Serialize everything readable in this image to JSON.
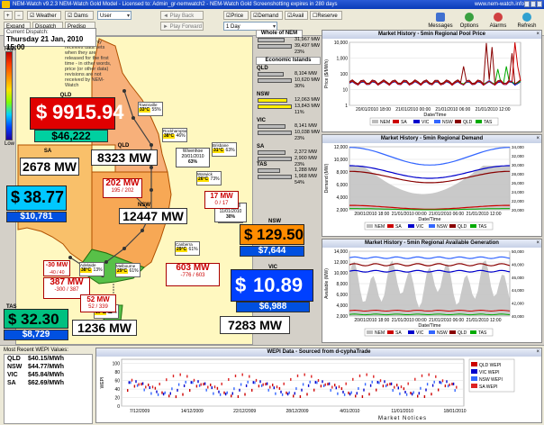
{
  "titlebar": {
    "text": "NEM-Watch v9.2.3 NEM-Watch Gold Model - Licensed to: Admin_gr-nemwatch2 - NEM-Watch Gold Screenshotting expires in 280 days",
    "right_text": "www.nem-watch.info"
  },
  "toolbar": {
    "weather_label": "Weather",
    "dams_label": "Dams",
    "user_select": "User",
    "play_back_label": "Play Back",
    "play_forward_label": "Play Forward",
    "price_label": "Price",
    "demand_label": "Demand",
    "avail_label": "Avail",
    "reserve_label": "Reserve",
    "period_select": "1 Day",
    "messages_label": "Messages",
    "options_label": "Options",
    "alarms_label": "Alarms",
    "refresh_label": "Refresh",
    "zoom_in": "Zoom In",
    "zoom_out": "Zoom Out",
    "expand_label": "Expand",
    "dispatch_label": "Dispatch",
    "predisp_label": "Predisp"
  },
  "dispatch": {
    "label": "Current Dispatch:",
    "time": "Thursday 21 Jan, 2010 15:00"
  },
  "legend": {
    "high": "High",
    "low": "Low"
  },
  "map": {
    "note": "NEM-Watch only receives data sets when they are released for the first time - in other words, price (or other data) revisions are not received by NEM-Watch",
    "weather_stations": [
      {
        "name": "Townsville",
        "temp": "33°C",
        "pct": "55%"
      },
      {
        "name": "Rockhampton",
        "temp": "38°C",
        "pct": "46%"
      },
      {
        "name": "Brisbane",
        "temp": "31°C",
        "pct": "63%"
      },
      {
        "name": "Warwick",
        "temp": "26°C",
        "pct": "73%"
      },
      {
        "name": "Sydney",
        "temp": "31°C",
        "pct": "63%"
      },
      {
        "name": "Canberra",
        "temp": "29°C",
        "pct": "61%"
      },
      {
        "name": "Melbourne",
        "temp": "29°C",
        "pct": "61%"
      },
      {
        "name": "Adelaide",
        "temp": "38°C",
        "pct": "13%"
      },
      {
        "name": "Hobart",
        "temp": "19°C",
        "pct": "53%"
      }
    ],
    "wivenhoe": {
      "name": "Wivenhoe",
      "date": "20/01/2010",
      "pct": "63%"
    },
    "lakelyell": {
      "name": "Lake Lyell",
      "date": "11/01/2010",
      "pct": "30%"
    }
  },
  "regions": {
    "qld": {
      "name": "QLD",
      "price": "9915.94",
      "demand": "$46,222",
      "mw": "8323 MW"
    },
    "sa": {
      "name": "SA",
      "price": "38.77",
      "demand": "$10,781",
      "mw": "2678 MW"
    },
    "nsw": {
      "name": "NSW",
      "price": "129.50",
      "demand": "$7,644",
      "mw": "12447 MW"
    },
    "vic": {
      "name": "VIC",
      "price": "10.89",
      "demand": "$6,988",
      "mw": "7283 MW"
    },
    "tas": {
      "name": "TAS",
      "price": "32.30",
      "demand": "$8,729",
      "mw": "1236 MW"
    },
    "dollar": "$"
  },
  "flows": {
    "qni": {
      "value": "202 MW",
      "range": "195 / 202"
    },
    "terr": {
      "value": "17 MW",
      "range": "0 / 17"
    },
    "vicnsw": {
      "value": "603 MW",
      "range": "-776 / 603"
    },
    "heywood": {
      "value": "387 MW",
      "range": "-300 / 387"
    },
    "murray": {
      "value": "-30 MW",
      "range": "-40 / 40"
    },
    "basslink": {
      "value": "52 MW",
      "range": "52 / 339"
    }
  },
  "side": {
    "header_nem": "Whole of NEM",
    "header_islands": "Economic Islands",
    "nem_vals": [
      "31,967 MW",
      "39,497 MW",
      "23%"
    ],
    "qld": {
      "label": "QLD",
      "vals": [
        "8,104 MW",
        "10,620 MW",
        "30%"
      ]
    },
    "nsw": {
      "label": "NSW",
      "vals": [
        "12,063 MW",
        "13,843 MW",
        "11%"
      ]
    },
    "vic": {
      "label": "VIC",
      "vals": [
        "8,141 MW",
        "10,038 MW",
        "23%"
      ]
    },
    "sa": {
      "label": "SA",
      "vals": [
        "2,372 MW",
        "2,900 MW",
        "23%"
      ]
    },
    "tas": {
      "label": "TAS",
      "vals": [
        "1,288 MW",
        "1,968 MW",
        "54%"
      ]
    }
  },
  "charts": {
    "price_title": "Market History - 5min Regional Pool Price",
    "demand_title": "Market History - 5min Regional Demand",
    "avail_title": "Market History - 5min Regional Available Generation",
    "date_time_label": "Date/Time",
    "price_ylabel": "Price ($/MWh)",
    "demand_ylabel": "Demand (MW)",
    "avail_ylabel": "Available (MW)",
    "close": "×"
  },
  "chart_data": [
    {
      "type": "line",
      "title": "Market History - 5min Regional Pool Price",
      "xlabel": "Date/Time",
      "ylabel": "Price ($/MWh)",
      "y_scale": "log",
      "yticks": [
        1,
        10,
        100,
        1000,
        10000
      ],
      "ylim": [
        1,
        10000
      ],
      "xticks": [
        "20/01/2010 18:00",
        "21/01/2010 00:00",
        "21/01/2010 06:00",
        "21/01/2010 12:00"
      ],
      "legend": [
        "NEM",
        "SA",
        "VIC",
        "NSW",
        "QLD",
        "TAS"
      ],
      "legend_position": "bottom"
    },
    {
      "type": "line",
      "title": "Market History - 5min Regional Demand",
      "xlabel": "Date/Time",
      "ylabel": "Demand (MW)",
      "yticks": [
        2000,
        4000,
        6000,
        8000,
        10000,
        12000
      ],
      "y2ticks": [
        20000,
        22000,
        24000,
        26000,
        28000,
        30000,
        32000,
        34000
      ],
      "xticks": [
        "20/01/2010 18:00",
        "21/01/2010 00:00",
        "21/01/2010 06:00",
        "21/01/2010 12:00"
      ],
      "legend": [
        "NEM",
        "SA",
        "VIC",
        "NSW",
        "QLD",
        "TAS"
      ],
      "legend_position": "bottom"
    },
    {
      "type": "line",
      "title": "Market History - 5min Regional Available Generation",
      "xlabel": "Date/Time",
      "ylabel": "Available (MW)",
      "yticks": [
        2000,
        4000,
        6000,
        8000,
        10000,
        12000,
        14000
      ],
      "y2ticks": [
        40000,
        42000,
        44000,
        46000,
        48000,
        50000
      ],
      "xticks": [
        "20/01/2010 18:00",
        "21/01/2010 00:00",
        "21/01/2010 06:00",
        "21/01/2010 12:00"
      ],
      "legend": [
        "NEM",
        "SA",
        "VIC",
        "NSW",
        "QLD",
        "TAS"
      ],
      "legend_position": "bottom"
    },
    {
      "type": "bar",
      "title": "WEPI Data - Sourced from d-cyphaTrade",
      "ylabel": "WEPI",
      "yticks": [
        0,
        20,
        40,
        60,
        80,
        100
      ],
      "ylim": [
        0,
        110
      ],
      "xticks": [
        "7/12/2009",
        "14/12/2009",
        "22/12/2009",
        "28/12/2009",
        "4/01/2010",
        "11/01/2010",
        "18/01/2010"
      ],
      "legend": [
        "QLD WEPI",
        "VIC WEPI",
        "NSW WEPI",
        "SA WEPI"
      ],
      "legend_position": "right"
    }
  ],
  "wepi": {
    "title": "WEPI Data - Sourced from d-cyphaTrade",
    "recent_label": "Most Recent WEPI Values:",
    "rows": [
      {
        "state": "QLD",
        "value": "$40.15/MWh"
      },
      {
        "state": "NSW",
        "value": "$44.77/MWh"
      },
      {
        "state": "VIC",
        "value": "$45.84/MWh"
      },
      {
        "state": "SA",
        "value": "$62.69/MWh"
      }
    ],
    "market_notices": "Market Notices"
  },
  "colors": {
    "qld_price_bg": "#e00000",
    "sa_price_bg": "#00c8ff",
    "nsw_price_bg": "#ff8c00",
    "vic_price_bg": "#0040ff",
    "tas_price_bg": "#00c080",
    "demand_bg": "#00d0a0"
  }
}
